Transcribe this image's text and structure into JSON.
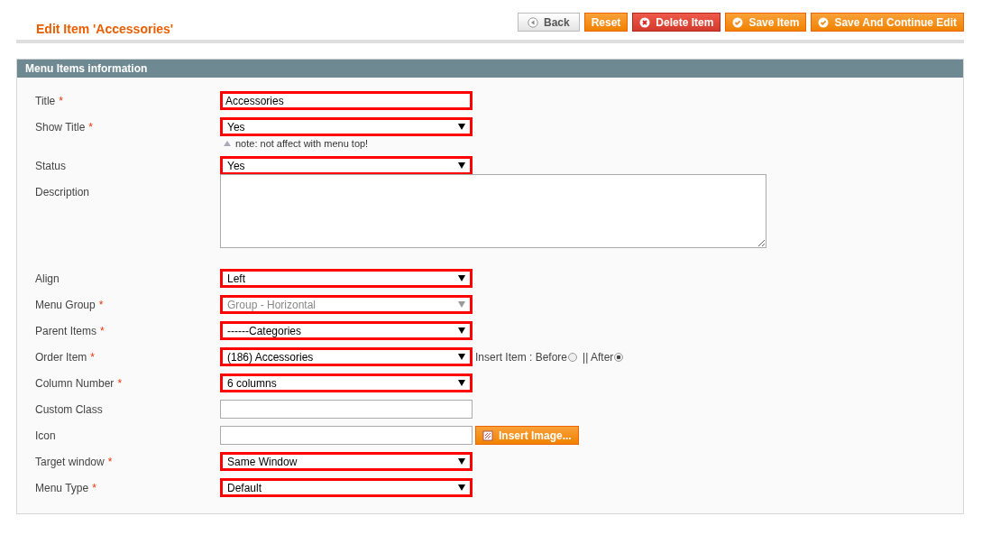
{
  "page_title": "Edit Item 'Accessories'",
  "buttons": [
    {
      "label": "Back",
      "kind": "back"
    },
    {
      "label": "Reset",
      "kind": "plain"
    },
    {
      "label": "Delete Item",
      "kind": "delete"
    },
    {
      "label": "Save Item",
      "kind": "save"
    },
    {
      "label": "Save And Continue Edit",
      "kind": "save"
    }
  ],
  "panel": {
    "title": "Menu Items information",
    "fields": [
      {
        "label": "Title",
        "required_mark": "*",
        "kind": "text",
        "value": "Accessories",
        "highlighted": true
      },
      {
        "label": "Show Title",
        "required_mark": "*",
        "kind": "select",
        "value": "Yes",
        "highlighted": true,
        "note": "note: not affect with menu top!"
      },
      {
        "label": "Status",
        "kind": "select",
        "value": "Yes",
        "highlighted": true
      },
      {
        "label": "Description",
        "kind": "textarea",
        "highlighted": false
      },
      {
        "label": "Align",
        "kind": "select",
        "value": "Left",
        "highlighted": true
      },
      {
        "label": "Menu Group",
        "required_mark": "*",
        "kind": "select",
        "value": "Group - Horizontal",
        "highlighted": true,
        "disabled": true
      },
      {
        "label": "Parent Items",
        "required_mark": "*",
        "kind": "select",
        "value": "------Categories",
        "highlighted": true
      },
      {
        "label": "Order Item",
        "required_mark": "*",
        "kind": "select",
        "value": "(186) Accessories",
        "highlighted": true,
        "radios": [
          {
            "label": "Insert Item : Before",
            "selected": false
          },
          {
            "label": "|| After",
            "selected": true
          }
        ]
      },
      {
        "label": "Column Number",
        "required_mark": "*",
        "kind": "select",
        "value": "6 columns",
        "highlighted": true
      },
      {
        "label": "Custom Class",
        "kind": "text",
        "highlighted": false
      },
      {
        "label": "Icon",
        "kind": "text",
        "highlighted": false,
        "button": "Insert Image..."
      },
      {
        "label": "Target window",
        "required_mark": "*",
        "kind": "select",
        "value": "Same Window",
        "highlighted": true
      },
      {
        "label": "Menu Type",
        "required_mark": "*",
        "kind": "select",
        "value": "Default",
        "highlighted": true
      }
    ]
  }
}
